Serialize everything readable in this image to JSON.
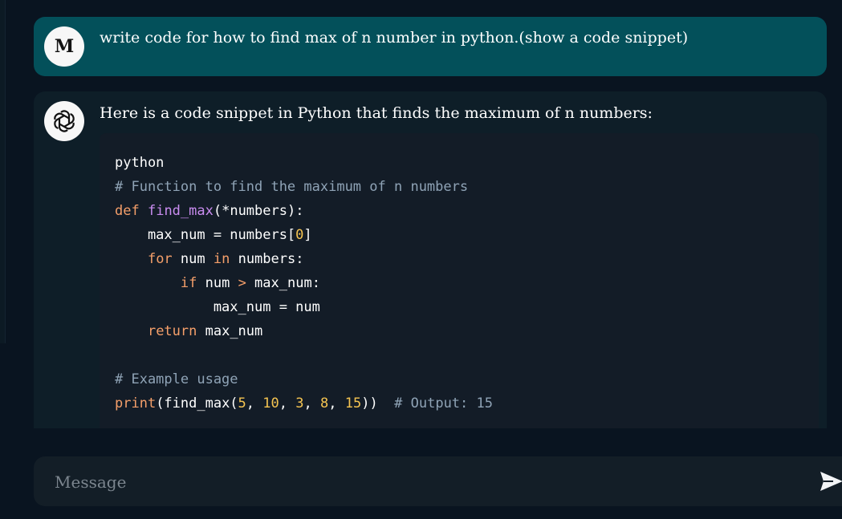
{
  "user_message": {
    "avatar_letter": "M",
    "text": "write code for how to find max of n number in python.(show a code snippet)"
  },
  "assistant_message": {
    "avatar_icon": "openai-logo-icon",
    "intro": "Here is a code snippet in Python that finds the maximum of n numbers:",
    "code_language": "python",
    "code_lines": [
      [
        {
          "t": "python",
          "c": "default"
        }
      ],
      [
        {
          "t": "# Function to find the maximum of n numbers",
          "c": "comment"
        }
      ],
      [
        {
          "t": "def",
          "c": "kw"
        },
        {
          "t": " ",
          "c": "default"
        },
        {
          "t": "find_max",
          "c": "fn"
        },
        {
          "t": "(*numbers):",
          "c": "default"
        }
      ],
      [
        {
          "t": "    max_num = numbers[",
          "c": "default"
        },
        {
          "t": "0",
          "c": "num"
        },
        {
          "t": "]",
          "c": "default"
        }
      ],
      [
        {
          "t": "    ",
          "c": "default"
        },
        {
          "t": "for",
          "c": "kw"
        },
        {
          "t": " num ",
          "c": "default"
        },
        {
          "t": "in",
          "c": "kw"
        },
        {
          "t": " numbers:",
          "c": "default"
        }
      ],
      [
        {
          "t": "        ",
          "c": "default"
        },
        {
          "t": "if",
          "c": "kw"
        },
        {
          "t": " num ",
          "c": "default"
        },
        {
          "t": ">",
          "c": "kw"
        },
        {
          "t": " max_num:",
          "c": "default"
        }
      ],
      [
        {
          "t": "            max_num = num",
          "c": "default"
        }
      ],
      [
        {
          "t": "    ",
          "c": "default"
        },
        {
          "t": "return",
          "c": "kw"
        },
        {
          "t": " max_num",
          "c": "default"
        }
      ],
      [
        {
          "t": "",
          "c": "default"
        }
      ],
      [
        {
          "t": "# Example usage",
          "c": "comment"
        }
      ],
      [
        {
          "t": "print",
          "c": "kw"
        },
        {
          "t": "(find_max(",
          "c": "default"
        },
        {
          "t": "5",
          "c": "num"
        },
        {
          "t": ", ",
          "c": "default"
        },
        {
          "t": "10",
          "c": "num"
        },
        {
          "t": ", ",
          "c": "default"
        },
        {
          "t": "3",
          "c": "num"
        },
        {
          "t": ", ",
          "c": "default"
        },
        {
          "t": "8",
          "c": "num"
        },
        {
          "t": ", ",
          "c": "default"
        },
        {
          "t": "15",
          "c": "num"
        },
        {
          "t": "))  ",
          "c": "default"
        },
        {
          "t": "# Output: 15",
          "c": "comment"
        }
      ]
    ]
  },
  "composer": {
    "placeholder": "Message",
    "send_icon": "send-arrow-icon"
  },
  "colors": {
    "background": "#091420",
    "user_bubble": "#03505a",
    "assistant_bubble": "#0e1e28",
    "code_bg": "#131c27",
    "keyword": "#f59f6a",
    "function": "#c98cf0",
    "number": "#f5c451",
    "comment": "#8fa3b6"
  }
}
